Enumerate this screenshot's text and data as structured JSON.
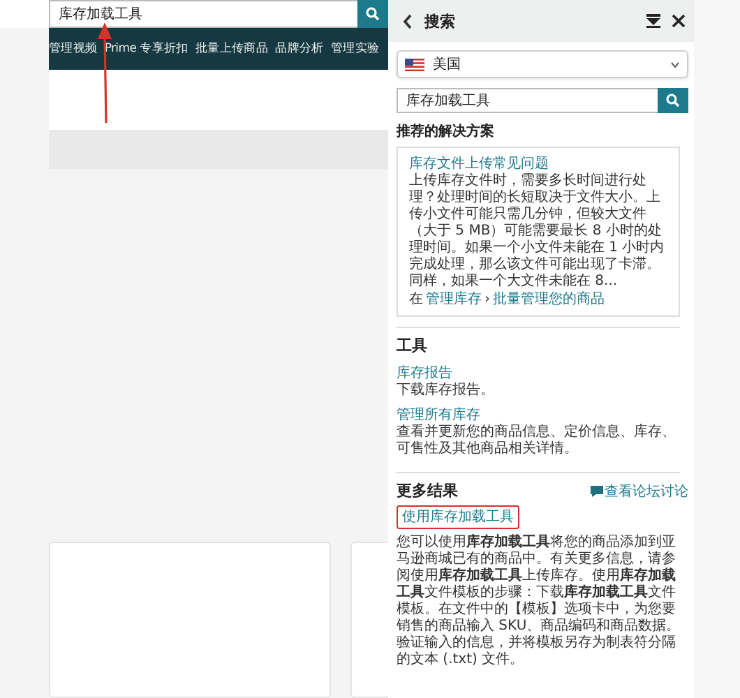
{
  "page": {
    "search": {
      "value": "库存加载工具"
    },
    "nav": [
      "管理视频",
      "Prime 专享折扣",
      "批量上传商品",
      "品牌分析",
      "管理实验"
    ]
  },
  "panel": {
    "title": "搜索",
    "country": "美国",
    "search": {
      "value": "库存加载工具"
    },
    "recommended": {
      "heading": "推荐的解决方案",
      "card": {
        "title": "库存文件上传常见问题",
        "text": "上传库存文件时，需要多长时间进行处理？处理时间的长短取决于文件大小。上传小文件可能只需几分钟，但较大文件（大于 5 MB）可能需要最长 8 小时的处理时间。如果一个小文件未能在 1 小时内完成处理，那么该文件可能出现了卡滞。同样，如果一个大文件未能在 8...",
        "path_prefix": "在",
        "path": [
          "管理库存",
          "批量管理您的商品"
        ],
        "separator": "›"
      }
    },
    "tools": {
      "heading": "工具",
      "items": [
        {
          "link": "库存报告",
          "description": "下载库存报告。"
        },
        {
          "link": "管理所有库存",
          "description": "查看并更新您的商品信息、定价信息、库存、可售性及其他商品相关详情。"
        }
      ]
    },
    "more": {
      "heading": "更多结果",
      "forum_link": "查看论坛讨论",
      "results": [
        {
          "title": "使用库存加载工具",
          "highlighted": true,
          "text": "您可以使用**库存加载工具**将您的商品添加到亚马逊商城已有的商品中。有关更多信息，请参阅使用**库存加载工具**上传库存。使用**库存加载工具**文件模板的步骤：下载**库存加载工具**文件模板。在文件中的【模板】选项卡中，为您要销售的商品输入 SKU、商品编码和商品数据。验证输入的信息，并将模板另存为制表符分隔的文本 (.txt) 文件。"
        }
      ]
    }
  }
}
